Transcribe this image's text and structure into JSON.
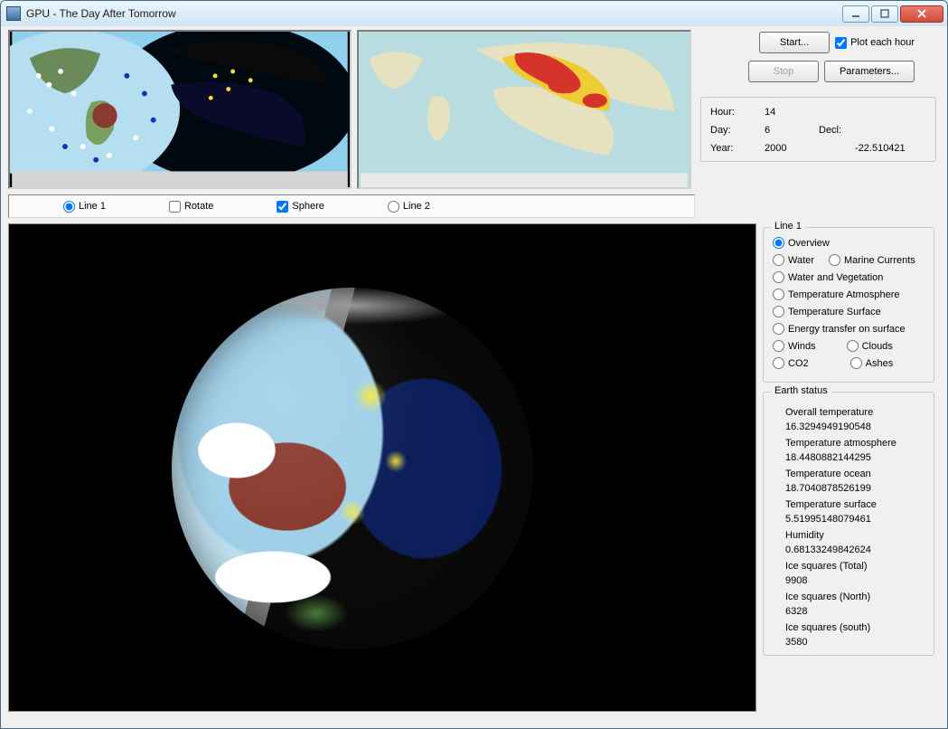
{
  "window": {
    "title": "GPU - The Day After Tomorrow"
  },
  "controls": {
    "start": "Start...",
    "stop": "Stop",
    "parameters": "Parameters...",
    "plot_each_hour": "Plot each hour"
  },
  "time_panel": {
    "hour_label": "Hour:",
    "hour_value": "14",
    "day_label": "Day:",
    "day_value": "6",
    "year_label": "Year:",
    "year_value": "2000",
    "decl_label": "Decl:",
    "decl_value": "-22.510421"
  },
  "view_bar": {
    "line1": "Line 1",
    "rotate": "Rotate",
    "sphere": "Sphere",
    "line2": "Line 2"
  },
  "line1_box": {
    "legend": "Line 1",
    "overview": "Overview",
    "water": "Water",
    "marine_currents": "Marine Currents",
    "water_vegetation": "Water and Vegetation",
    "temp_atmosphere": "Temperature Atmosphere",
    "temp_surface": "Temperature Surface",
    "energy_transfer": "Energy transfer on surface",
    "winds": "Winds",
    "clouds": "Clouds",
    "co2": "CO2",
    "ashes": "Ashes"
  },
  "earth_status": {
    "legend": "Earth status",
    "overall_temp_label": "Overall temperature",
    "overall_temp_value": "16.3294949190548",
    "temp_atm_label": "Temperature atmosphere",
    "temp_atm_value": "18.4480882144295",
    "temp_ocean_label": "Temperature ocean",
    "temp_ocean_value": "18.7040878526199",
    "temp_surf_label": "Temperature surface",
    "temp_surf_value": "5.51995148079461",
    "humidity_label": "Humidity",
    "humidity_value": "0.68133249842624",
    "ice_total_label": "Ice squares (Total)",
    "ice_total_value": "9908",
    "ice_north_label": "Ice squares (North)",
    "ice_north_value": "6328",
    "ice_south_label": "Ice squares (south)",
    "ice_south_value": "3580"
  }
}
